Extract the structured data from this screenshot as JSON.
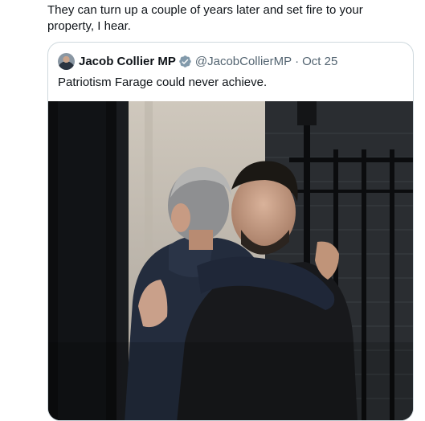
{
  "post": {
    "text": "They can turn up a couple of years later and set fire to your property, I hear."
  },
  "quoted_post": {
    "display_name": "Jacob Collier MP",
    "handle": "@JacobCollierMP",
    "separator": "·",
    "date": "Oct 25",
    "text": "Patriotism Farage could never achieve.",
    "avatar_icon": "profile-avatar",
    "verified_icon": "verified-badge-icon",
    "verified_color": "#829aab"
  },
  "colors": {
    "text_primary": "#0f1419",
    "text_secondary": "#536471",
    "border": "#cfd9de"
  }
}
